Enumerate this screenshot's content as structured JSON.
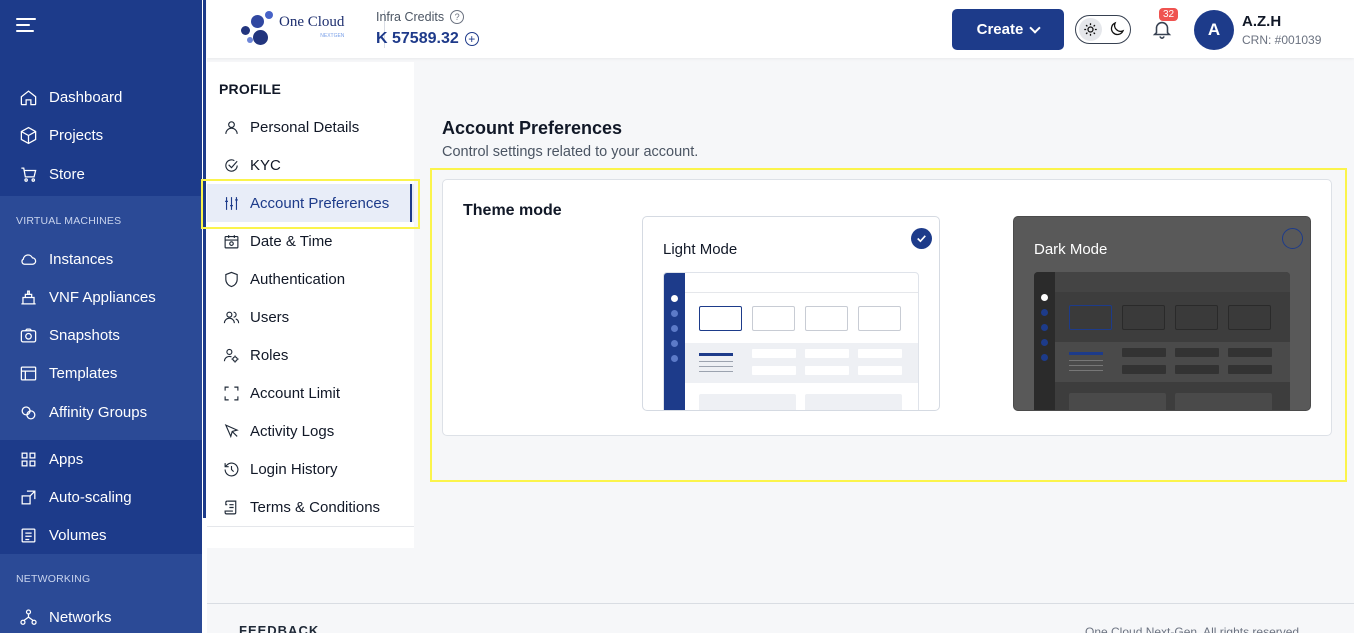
{
  "sidebar": {
    "items_top": [
      {
        "label": "Dashboard",
        "icon": "home-icon"
      },
      {
        "label": "Projects",
        "icon": "cube-icon"
      },
      {
        "label": "Store",
        "icon": "cart-icon"
      }
    ],
    "section_vm": "VIRTUAL MACHINES",
    "items_vm": [
      {
        "label": "Instances",
        "icon": "cloud-icon"
      },
      {
        "label": "VNF Appliances",
        "icon": "firewall-icon"
      },
      {
        "label": "Snapshots",
        "icon": "camera-icon"
      },
      {
        "label": "Templates",
        "icon": "template-icon"
      },
      {
        "label": "Affinity Groups",
        "icon": "affinity-icon"
      }
    ],
    "items_apps": [
      {
        "label": "Apps",
        "icon": "grid-icon"
      },
      {
        "label": "Auto-scaling",
        "icon": "scale-icon"
      },
      {
        "label": "Volumes",
        "icon": "volume-icon"
      }
    ],
    "section_net": "NETWORKING",
    "items_net": [
      {
        "label": "Networks",
        "icon": "network-icon"
      }
    ]
  },
  "header": {
    "logo_text": "One Cloud",
    "logo_sub": "NEXTGEN",
    "credits_label": "Infra Credits",
    "credits_value": "K 57589.32",
    "create_label": "Create",
    "notification_count": "32",
    "avatar_initial": "A",
    "user_name": "A.Z.H",
    "user_crn": "CRN: #001039"
  },
  "profile_nav": {
    "title": "PROFILE",
    "items": [
      {
        "label": "Personal Details",
        "icon": "user-icon"
      },
      {
        "label": "KYC",
        "icon": "check-circle-icon"
      },
      {
        "label": "Account Preferences",
        "icon": "sliders-icon"
      },
      {
        "label": "Date & Time",
        "icon": "calendar-icon"
      },
      {
        "label": "Authentication",
        "icon": "shield-icon"
      },
      {
        "label": "Users",
        "icon": "users-icon"
      },
      {
        "label": "Roles",
        "icon": "user-gear-icon"
      },
      {
        "label": "Account Limit",
        "icon": "frame-icon"
      },
      {
        "label": "Activity Logs",
        "icon": "cursor-icon"
      },
      {
        "label": "Login History",
        "icon": "history-icon"
      },
      {
        "label": "Terms & Conditions",
        "icon": "scroll-icon"
      }
    ],
    "active_index": 2
  },
  "main": {
    "title": "Account Preferences",
    "subtitle": "Control settings related to your account.",
    "theme_label": "Theme mode",
    "light_label": "Light Mode",
    "dark_label": "Dark Mode",
    "selected": "Light Mode"
  },
  "footer": {
    "left": "FEEDBACK",
    "right": "One Cloud Next-Gen. All rights reserved."
  },
  "colors": {
    "primary": "#1d3b8a",
    "highlight": "#fbf44c",
    "badge": "#ef5350"
  }
}
